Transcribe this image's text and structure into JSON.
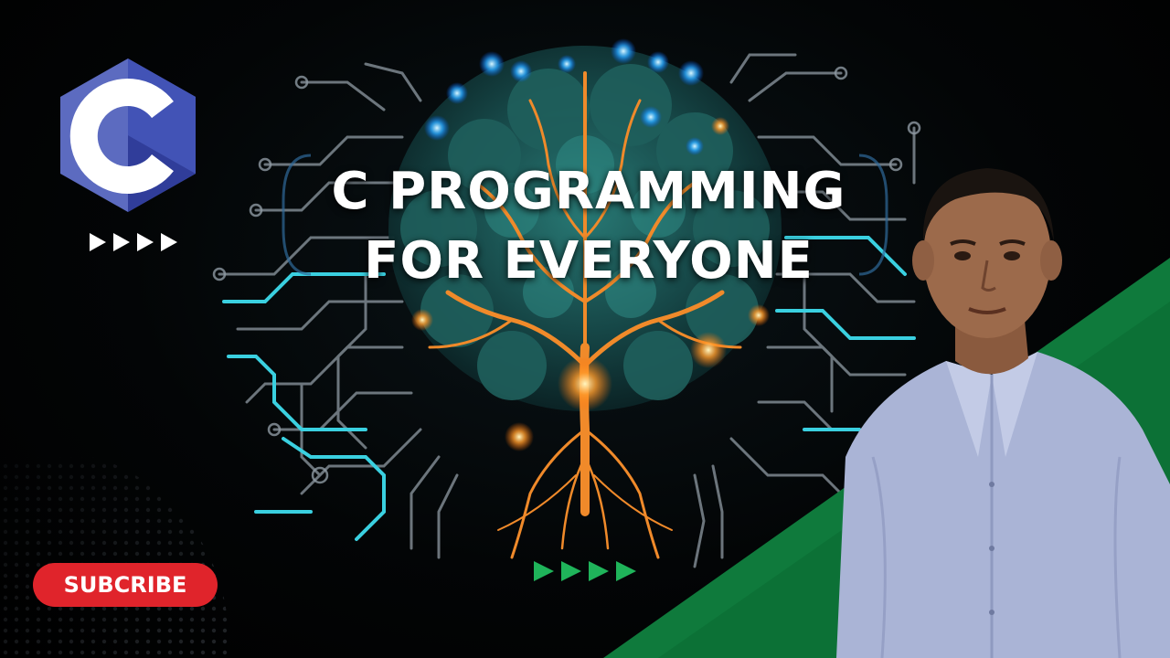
{
  "title": {
    "line1": "C PROGRAMMING",
    "line2": "FOR EVERYONE"
  },
  "subscribe_label": "SUBCRIBE",
  "logo": {
    "letter": "C",
    "icon": "c-language-logo"
  },
  "icons": {
    "white_arrows": "play-arrows-icon",
    "green_arrows": "play-arrows-icon"
  },
  "colors": {
    "subscribe_red": "#e0242b",
    "accent_green": "#0f7a3c",
    "logo_purple": "#5c6bc0",
    "circuit_cyan": "#3ad0e0",
    "tree_orange": "#f08a2a"
  }
}
